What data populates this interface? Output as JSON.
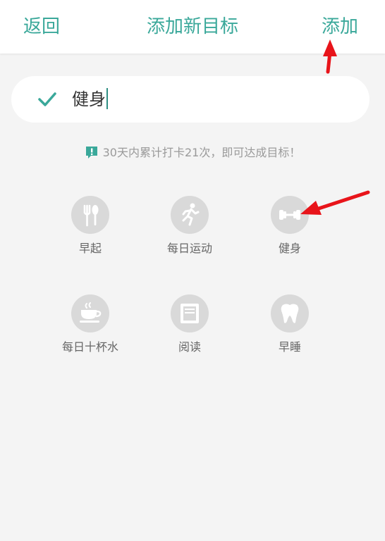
{
  "header": {
    "back_label": "返回",
    "title": "添加新目标",
    "add_label": "添加"
  },
  "goal_input": {
    "value": "健身"
  },
  "hint": {
    "text": "30天内累计打卡21次，即可达成目标！"
  },
  "presets": [
    {
      "label": "早起",
      "icon": "fork-spoon-icon"
    },
    {
      "label": "每日运动",
      "icon": "running-icon"
    },
    {
      "label": "健身",
      "icon": "dumbbell-icon"
    },
    {
      "label": "每日十杯水",
      "icon": "coffee-cup-icon"
    },
    {
      "label": "阅读",
      "icon": "book-icon"
    },
    {
      "label": "早睡",
      "icon": "tooth-icon"
    }
  ],
  "colors": {
    "accent": "#3aa89a",
    "icon_bg": "#d9d9d9",
    "annotation_arrow": "#e8141a"
  }
}
